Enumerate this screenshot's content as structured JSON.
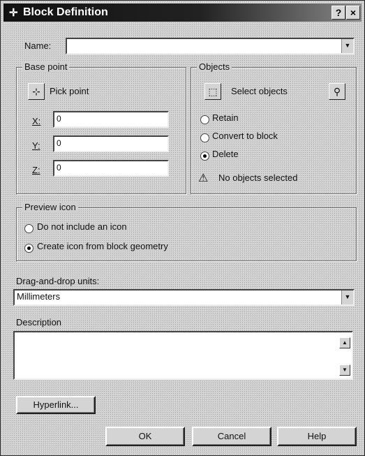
{
  "title": "Block Definition",
  "title_buttons": {
    "help": "?",
    "close": "×"
  },
  "name": {
    "label": "Name:",
    "value": ""
  },
  "base_point": {
    "title": "Base point",
    "pick_label": "Pick point",
    "x_label": "X:",
    "x_value": "0",
    "y_label": "Y:",
    "y_value": "0",
    "z_label": "Z:",
    "z_value": "0"
  },
  "objects": {
    "title": "Objects",
    "select_label": "Select objects",
    "retain": "Retain",
    "convert": "Convert to block",
    "delete": "Delete",
    "selected": "delete",
    "status": "No objects selected"
  },
  "preview": {
    "title": "Preview icon",
    "no_icon": "Do not include an icon",
    "create_icon": "Create icon from block geometry",
    "selected": "create_icon"
  },
  "units": {
    "label": "Drag-and-drop units:",
    "value": "Millimeters"
  },
  "description": {
    "label": "Description",
    "value": ""
  },
  "buttons": {
    "hyperlink": "Hyperlink...",
    "ok": "OK",
    "cancel": "Cancel",
    "help": "Help"
  }
}
